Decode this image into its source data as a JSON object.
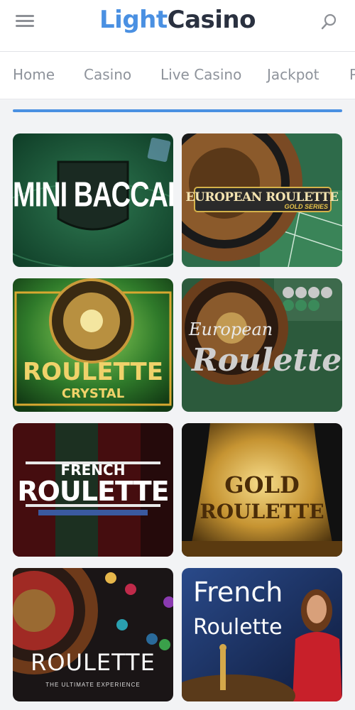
{
  "header": {
    "logo_light": "Light",
    "logo_casino": "Casino",
    "menu_icon": "hamburger-menu-icon",
    "search_icon": "search-icon"
  },
  "nav": {
    "items": [
      {
        "label": "Home"
      },
      {
        "label": "Casino"
      },
      {
        "label": "Live Casino"
      },
      {
        "label": "Jackpot"
      },
      {
        "label": "P"
      }
    ]
  },
  "colors": {
    "accent": "#4a90e2",
    "logo_dark": "#2a3140",
    "nav_text": "#8e939b"
  },
  "games": [
    {
      "line1": "MINI BACCARAT",
      "line2": ""
    },
    {
      "line1": "EUROPEAN ROULETTE",
      "line2": "GOLD SERIES"
    },
    {
      "line1": "ROULETTE",
      "line2": "CRYSTAL"
    },
    {
      "line1": "European",
      "line2": "Roulette"
    },
    {
      "line1": "FRENCH",
      "line2": "ROULETTE"
    },
    {
      "line1": "GOLD",
      "line2": "ROULETTE"
    },
    {
      "line1": "ROULETTE",
      "line2": "THE ULTIMATE EXPERIENCE"
    },
    {
      "line1": "French",
      "line2": "Roulette"
    }
  ]
}
